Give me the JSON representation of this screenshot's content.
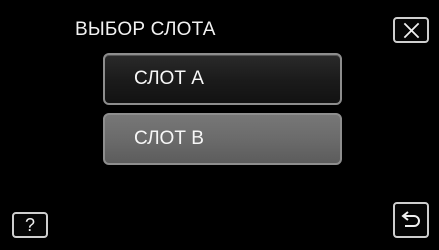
{
  "header": {
    "title": "ВЫБОР СЛОТА",
    "close_icon": "close-icon"
  },
  "options": [
    {
      "label": "СЛОТ A",
      "selected": false
    },
    {
      "label": "СЛОТ B",
      "selected": true
    }
  ],
  "footer": {
    "help_label": "?",
    "back_icon": "back-icon"
  },
  "colors": {
    "background": "#000000",
    "text": "#f2f2f2",
    "button_border": "#cfcfcf",
    "slot_default": "#1f1f1f",
    "slot_selected": "#6b6b6b"
  }
}
